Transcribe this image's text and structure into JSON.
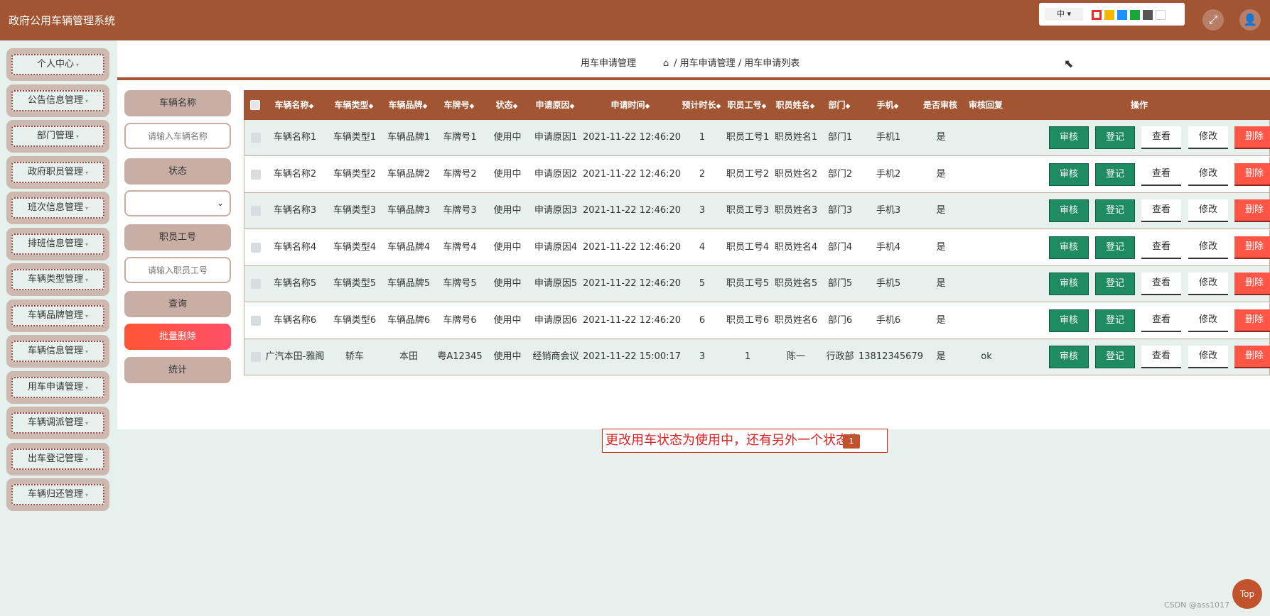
{
  "header": {
    "app_title": "政府公用车辆管理系统",
    "lang_label": "中",
    "swatch_colors": [
      "#e8302a",
      "#f5b800",
      "#1e90ff",
      "#18a83a",
      "#555555",
      "#ffffff"
    ]
  },
  "sidebar": {
    "items": [
      {
        "label": "个人中心"
      },
      {
        "label": "公告信息管理"
      },
      {
        "label": "部门管理"
      },
      {
        "label": "政府职员管理"
      },
      {
        "label": "班次信息管理"
      },
      {
        "label": "排班信息管理"
      },
      {
        "label": "车辆类型管理"
      },
      {
        "label": "车辆品牌管理"
      },
      {
        "label": "车辆信息管理"
      },
      {
        "label": "用车申请管理"
      },
      {
        "label": "车辆调派管理"
      },
      {
        "label": "出车登记管理"
      },
      {
        "label": "车辆归还管理"
      }
    ]
  },
  "breadcrumb": {
    "title": "用车申请管理",
    "path": "/ 用车申请管理 / 用车申请列表"
  },
  "filters": {
    "vehicle_name_label": "车辆名称",
    "vehicle_name_placeholder": "请输入车辆名称",
    "status_label": "状态",
    "status_value": "",
    "staff_id_label": "职员工号",
    "staff_id_placeholder": "请输入职员工号",
    "query_label": "查询",
    "batch_delete_label": "批量删除",
    "stats_label": "统计"
  },
  "table": {
    "columns": [
      "车辆名称",
      "车辆类型",
      "车辆品牌",
      "车牌号",
      "状态",
      "申请原因",
      "申请时间",
      "预计时长",
      "职员工号",
      "职员姓名",
      "部门",
      "手机",
      "是否审核",
      "审核回复",
      "操作"
    ],
    "sort_glyph": "◆",
    "rows": [
      [
        "车辆名称1",
        "车辆类型1",
        "车辆品牌1",
        "车牌号1",
        "使用中",
        "申请原因1",
        "2021-11-22 12:46:20",
        "1",
        "职员工号1",
        "职员姓名1",
        "部门1",
        "手机1",
        "是",
        ""
      ],
      [
        "车辆名称2",
        "车辆类型2",
        "车辆品牌2",
        "车牌号2",
        "使用中",
        "申请原因2",
        "2021-11-22 12:46:20",
        "2",
        "职员工号2",
        "职员姓名2",
        "部门2",
        "手机2",
        "是",
        ""
      ],
      [
        "车辆名称3",
        "车辆类型3",
        "车辆品牌3",
        "车牌号3",
        "使用中",
        "申请原因3",
        "2021-11-22 12:46:20",
        "3",
        "职员工号3",
        "职员姓名3",
        "部门3",
        "手机3",
        "是",
        ""
      ],
      [
        "车辆名称4",
        "车辆类型4",
        "车辆品牌4",
        "车牌号4",
        "使用中",
        "申请原因4",
        "2021-11-22 12:46:20",
        "4",
        "职员工号4",
        "职员姓名4",
        "部门4",
        "手机4",
        "是",
        ""
      ],
      [
        "车辆名称5",
        "车辆类型5",
        "车辆品牌5",
        "车牌号5",
        "使用中",
        "申请原因5",
        "2021-11-22 12:46:20",
        "5",
        "职员工号5",
        "职员姓名5",
        "部门5",
        "手机5",
        "是",
        ""
      ],
      [
        "车辆名称6",
        "车辆类型6",
        "车辆品牌6",
        "车牌号6",
        "使用中",
        "申请原因6",
        "2021-11-22 12:46:20",
        "6",
        "职员工号6",
        "职员姓名6",
        "部门6",
        "手机6",
        "是",
        ""
      ],
      [
        "广汽本田-雅阁",
        "轿车",
        "本田",
        "粤A12345",
        "使用中",
        "经销商会议",
        "2021-11-22 15:00:17",
        "3",
        "1",
        "陈一",
        "行政部",
        "13812345679",
        "是",
        "ok"
      ]
    ],
    "actions": [
      "审核",
      "登记",
      "查看",
      "修改",
      "删除"
    ],
    "row_colors": [
      "#e6f1ed",
      "#ffffff"
    ]
  },
  "annotation": {
    "text": "更改用车状态为使用中，还有另外一个状态为",
    "pager_page": "1"
  },
  "top_button": "Top",
  "watermark": "CSDN @ass1017"
}
